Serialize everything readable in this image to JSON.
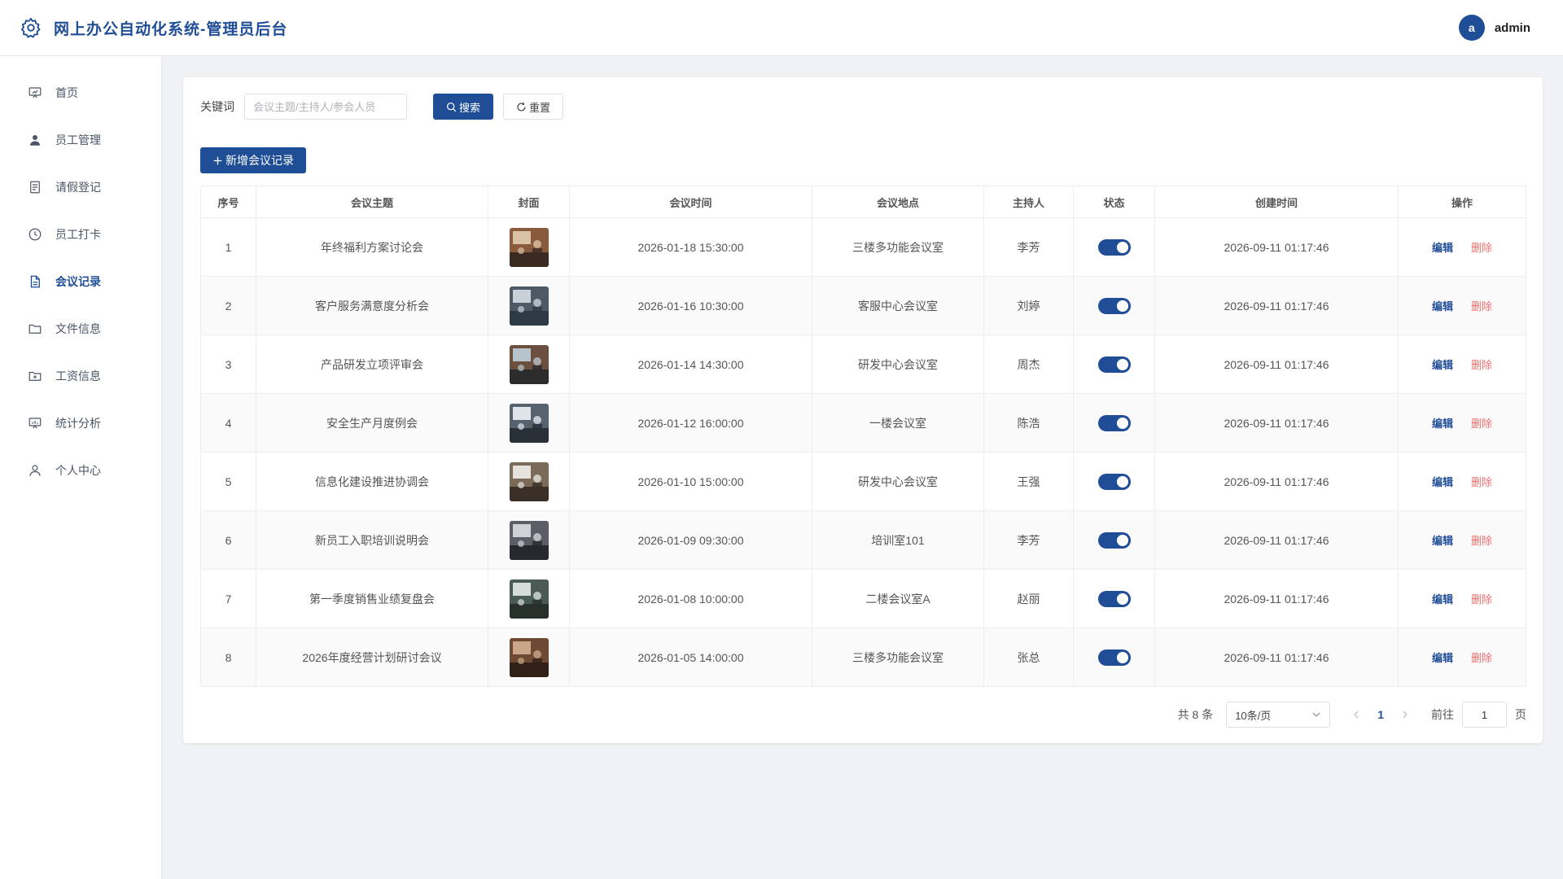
{
  "app": {
    "title": "网上办公自动化系统-管理员后台"
  },
  "user": {
    "avatar_letter": "a",
    "name": "admin"
  },
  "sidebar": {
    "items": [
      {
        "label": "首页",
        "icon": "presentation-icon"
      },
      {
        "label": "员工管理",
        "icon": "user-icon"
      },
      {
        "label": "请假登记",
        "icon": "document-icon"
      },
      {
        "label": "员工打卡",
        "icon": "clock-icon"
      },
      {
        "label": "会议记录",
        "icon": "file-icon"
      },
      {
        "label": "文件信息",
        "icon": "folder-icon"
      },
      {
        "label": "工资信息",
        "icon": "folder-add-icon"
      },
      {
        "label": "统计分析",
        "icon": "chart-board-icon"
      },
      {
        "label": "个人中心",
        "icon": "person-icon"
      }
    ],
    "active": "会议记录"
  },
  "search": {
    "label": "关键词",
    "placeholder": "会议主题/主持人/参会人员",
    "value": "",
    "search_label": "搜索",
    "reset_label": "重置"
  },
  "toolbar": {
    "add_label": "新增会议记录"
  },
  "table": {
    "headers": [
      "序号",
      "会议主题",
      "封面",
      "会议时间",
      "会议地点",
      "主持人",
      "状态",
      "创建时间",
      "操作"
    ],
    "edit_label": "编辑",
    "delete_label": "删除",
    "rows": [
      {
        "no": "1",
        "topic": "年终福利方案讨论会",
        "time": "2026-01-18 15:30:00",
        "place": "三楼多功能会议室",
        "host": "李芳",
        "status": true,
        "created": "2026-09-11 01:17:46"
      },
      {
        "no": "2",
        "topic": "客户服务满意度分析会",
        "time": "2026-01-16 10:30:00",
        "place": "客服中心会议室",
        "host": "刘婷",
        "status": true,
        "created": "2026-09-11 01:17:46"
      },
      {
        "no": "3",
        "topic": "产品研发立项评审会",
        "time": "2026-01-14 14:30:00",
        "place": "研发中心会议室",
        "host": "周杰",
        "status": true,
        "created": "2026-09-11 01:17:46"
      },
      {
        "no": "4",
        "topic": "安全生产月度例会",
        "time": "2026-01-12 16:00:00",
        "place": "一楼会议室",
        "host": "陈浩",
        "status": true,
        "created": "2026-09-11 01:17:46"
      },
      {
        "no": "5",
        "topic": "信息化建设推进协调会",
        "time": "2026-01-10 15:00:00",
        "place": "研发中心会议室",
        "host": "王强",
        "status": true,
        "created": "2026-09-11 01:17:46"
      },
      {
        "no": "6",
        "topic": "新员工入职培训说明会",
        "time": "2026-01-09 09:30:00",
        "place": "培训室101",
        "host": "李芳",
        "status": true,
        "created": "2026-09-11 01:17:46"
      },
      {
        "no": "7",
        "topic": "第一季度销售业绩复盘会",
        "time": "2026-01-08 10:00:00",
        "place": "二楼会议室A",
        "host": "赵丽",
        "status": true,
        "created": "2026-09-11 01:17:46"
      },
      {
        "no": "8",
        "topic": "2026年度经营计划研讨会议",
        "time": "2026-01-05 14:00:00",
        "place": "三楼多功能会议室",
        "host": "张总",
        "status": true,
        "created": "2026-09-11 01:17:46"
      }
    ]
  },
  "pagination": {
    "total": "共 8 条",
    "page_size": "10条/页",
    "current_page": "1",
    "goto_label": "前往",
    "goto_value": "1",
    "page_suffix": "页"
  },
  "colors": {
    "primary": "#1f4e96",
    "danger": "#f56c6c",
    "background": "#f0f2f5"
  }
}
